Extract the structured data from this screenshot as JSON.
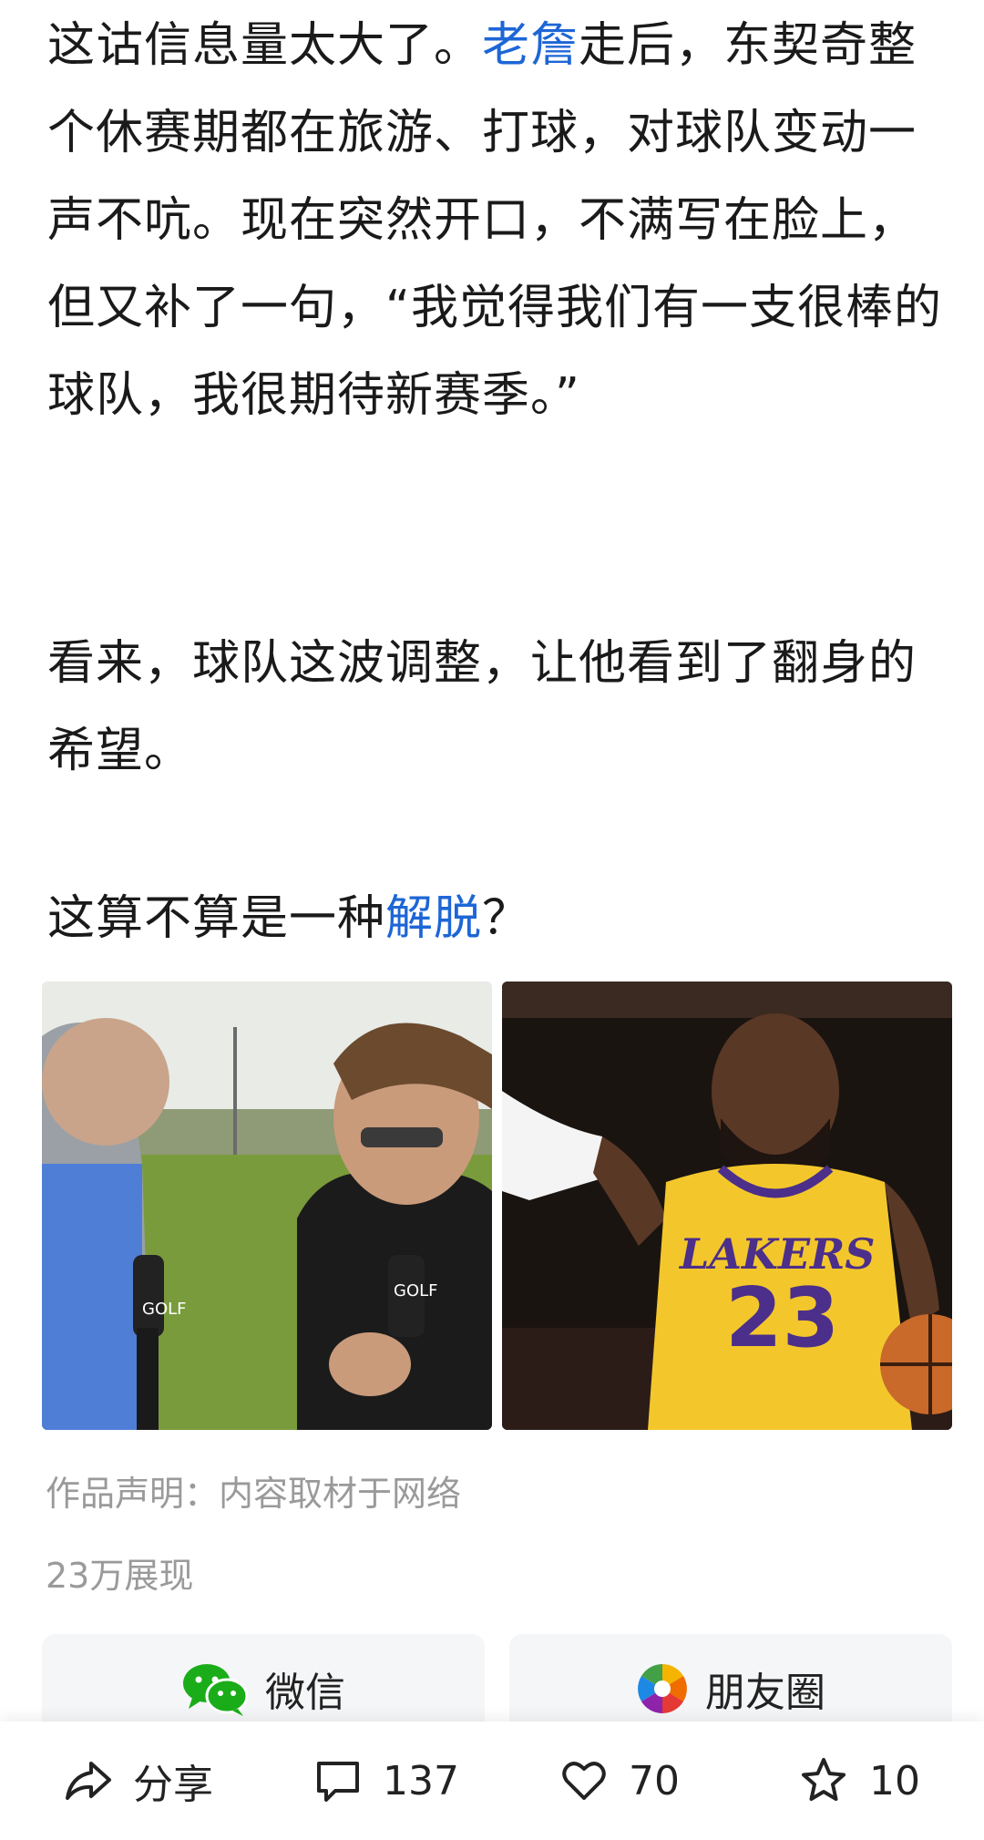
{
  "article": {
    "p1_a": "这诂信息量太大了。",
    "p1_link": "老詹",
    "p1_b": "走后，东契奇整个休赛期都在旅游、打球，对球队变动一声不吭。现在突然开口，不满写在脸上，但又补了一句，“我觉得我们有一支很棒的球队，我很期待新赛季。”",
    "p2": "看来，球队这波调整，让他看到了翻身的希望。",
    "p3_a": "这算不算是一种",
    "p3_link": "解脱",
    "p3_b": "？"
  },
  "images": {
    "left_mic_text": "GOLF",
    "right_jersey_team": "LAKERS",
    "right_jersey_number": "23"
  },
  "meta": {
    "declaration": "作品声明：内容取材于网络",
    "views": "23万展现"
  },
  "share": {
    "wechat_label": "微信",
    "moments_label": "朋友圈"
  },
  "bottom_bar": {
    "share_label": "分享",
    "comments": "137",
    "likes": "70",
    "favorites": "10"
  },
  "colors": {
    "link": "#1d66d6",
    "meta": "#9a9a9a",
    "wechat": "#1aad19"
  }
}
